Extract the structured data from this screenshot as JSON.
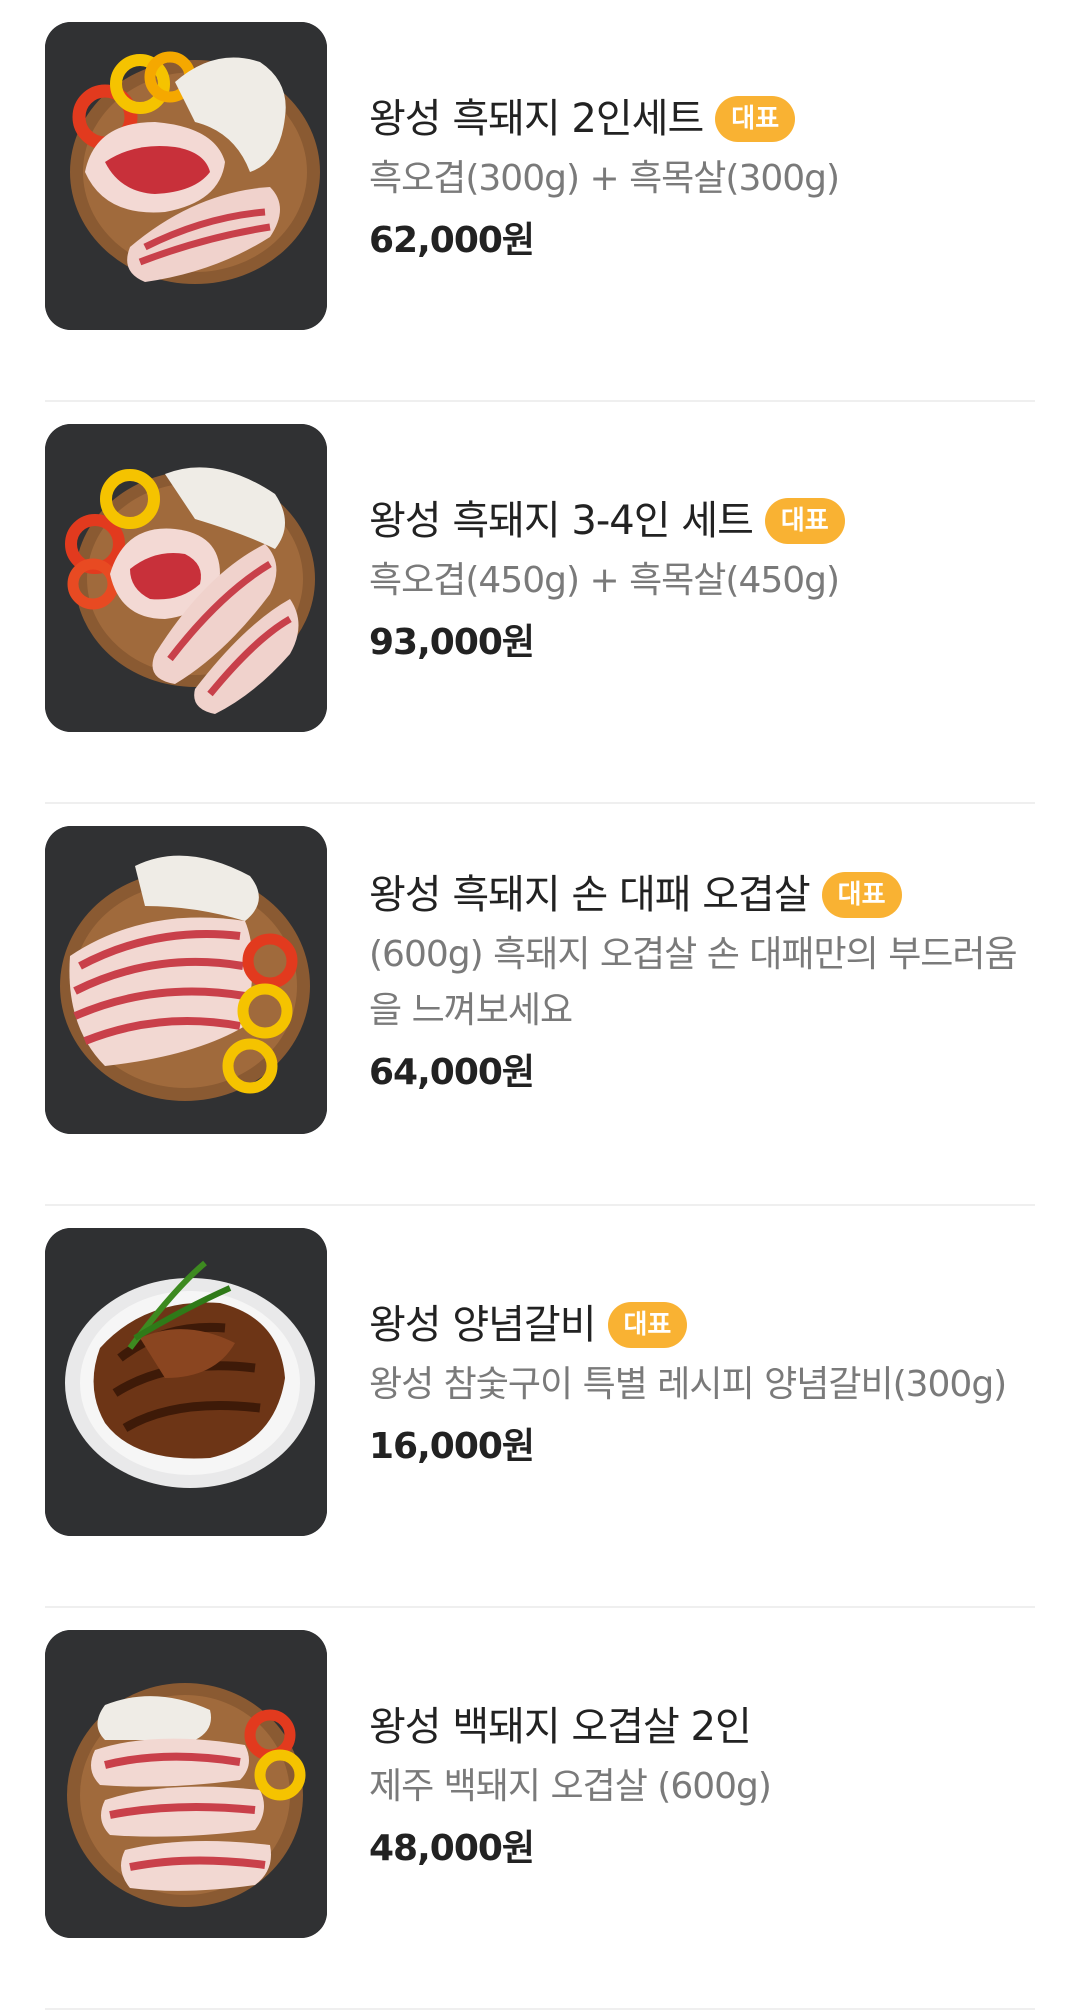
{
  "menu_items": [
    {
      "name": "왕성 흑돼지 2인세트",
      "badge": "대표",
      "description": "흑오겹(300g) + 흑목살(300g)",
      "price": "62,000원",
      "image": "black-pork-set-2-photo"
    },
    {
      "name": "왕성 흑돼지 3-4인 세트",
      "badge": "대표",
      "description": "흑오겹(450g) + 흑목살(450g)",
      "price": "93,000원",
      "image": "black-pork-set-3-4-photo"
    },
    {
      "name": "왕성 흑돼지 손 대패 오겹살",
      "badge": "대표",
      "description": "(600g) 흑돼지 오겹살 손 대패만의 부드러움을 느껴보세요",
      "price": "64,000원",
      "image": "hand-sliced-pork-belly-photo"
    },
    {
      "name": "왕성 양념갈비",
      "badge": "대표",
      "description": "왕성 참숯구이 특별 레시피 양념갈비(300g)",
      "price": "16,000원",
      "image": "marinated-galbi-photo"
    },
    {
      "name": "왕성 백돼지 오겹살 2인",
      "badge": "",
      "description": "제주 백돼지 오겹살 (600g)",
      "price": "48,000원",
      "image": "white-pork-belly-photo"
    }
  ],
  "colors": {
    "badge": "#f9b233",
    "price": "#222222",
    "description": "#7a7a7a",
    "divider": "#efefef"
  }
}
